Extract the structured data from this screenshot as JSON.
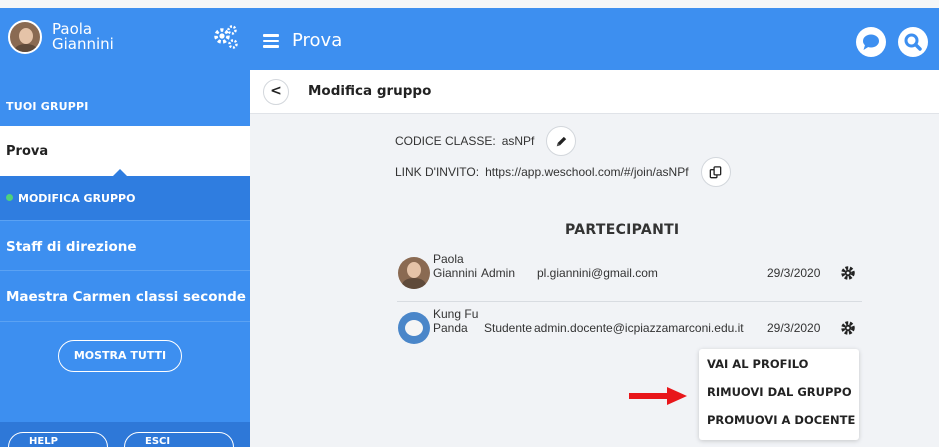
{
  "sidebar": {
    "user_name": "Paola Giannini",
    "section_label": "TUOI GRUPPI",
    "active_group": "Prova",
    "edit_group_label": "MODIFICA GRUPPO",
    "groups": [
      {
        "label": "Staff di direzione"
      },
      {
        "label": "Maestra Carmen classi seconde"
      }
    ],
    "show_all_label": "MOSTRA TUTTI",
    "bottom_buttons": [
      {
        "label": "HELP"
      },
      {
        "label": "ESCI"
      }
    ]
  },
  "header": {
    "title": "Prova"
  },
  "main": {
    "back_label": "<",
    "subtitle": "Modifica gruppo",
    "class_code_label": "CODICE CLASSE:",
    "class_code_value": "asNPf",
    "invite_link_label": "LINK D'INVITO:",
    "invite_link_value": "https://app.weschool.com/#/join/asNPf",
    "participants_title": "PARTECIPANTI",
    "participants": [
      {
        "first_name": "Paola",
        "last_name": "Giannini",
        "role": "Admin",
        "email": "pl.giannini@gmail.com",
        "date": "29/3/2020"
      },
      {
        "first_name": "Kung Fu",
        "last_name": "Panda",
        "role": "Studente",
        "email": "admin.docente@icpiazzamarconi.edu.it",
        "date": "29/3/2020"
      }
    ]
  },
  "context_menu": {
    "items": [
      "VAI AL PROFILO",
      "RIMUOVI DAL GRUPPO",
      "PROMUOVI A DOCENTE"
    ]
  },
  "colors": {
    "primary": "#3d8ff0",
    "primary_dark": "#2f7de0",
    "arrow": "#e8161a",
    "online_dot": "#4fd27a"
  },
  "icons": {
    "settings": "gears-icon",
    "menu": "hamburger-menu-icon",
    "chat": "chat-bubble-icon",
    "search": "search-icon",
    "edit": "pencil-icon",
    "copy": "copy-icon",
    "participant_settings": "gear-icon",
    "annotation": "red-arrow"
  }
}
